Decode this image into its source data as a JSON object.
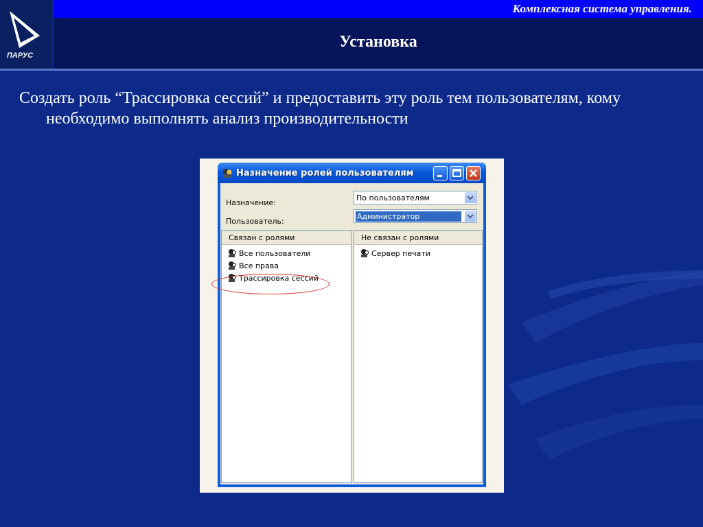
{
  "header": {
    "subtitle": "Комплексная система управления.",
    "title": "Установка",
    "logo_text": "ПАРУС"
  },
  "body": {
    "bullet_line1": "Создать роль “Трассировка сессий” и предоставить эту роль тем пользователям, кому",
    "bullet_line2": "необходимо выполнять анализ производительности"
  },
  "dialog": {
    "title": "Назначение ролей пользователям",
    "assignment_label": "Назначение:",
    "assignment_value": "По пользователям",
    "user_label": "Пользователь:",
    "user_value": "Администратор",
    "left_pane": {
      "header": "Связан с ролями",
      "items": [
        "Все пользователи",
        "Все права",
        "Трассировка сессий"
      ]
    },
    "right_pane": {
      "header": "Не связан с ролями",
      "items": [
        "Сервер печати"
      ]
    }
  },
  "colors": {
    "background": "#0d2a8a",
    "top_bar": "#0000ff",
    "title_bar": "#06145a",
    "highlight_ellipse": "#e0302a"
  },
  "icons": {
    "window_icon": "users-icon",
    "role_icon": "role-icon",
    "minimize": "minimize-icon",
    "maximize": "maximize-icon",
    "close": "close-icon"
  }
}
